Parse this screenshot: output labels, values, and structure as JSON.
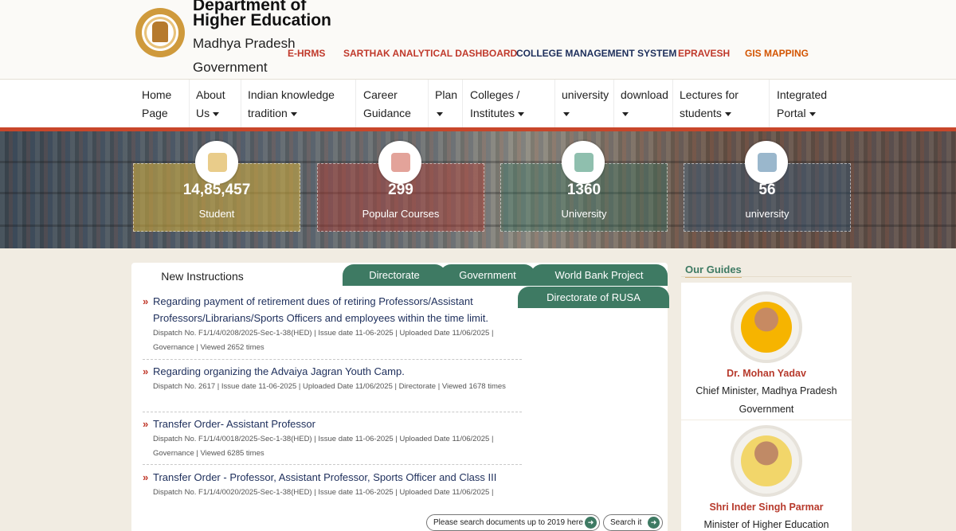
{
  "brand": {
    "title": "Department of Higher Education",
    "subtitle": "Madhya Pradesh Government"
  },
  "quick_links": [
    {
      "label": "E-HRMS",
      "color": "#c0392b"
    },
    {
      "label": "SARTHAK ANALYTICAL DASHBOARD",
      "color": "#c0392b"
    },
    {
      "label": "COLLEGE MANAGEMENT SYSTEM",
      "color": "#1d2e5b"
    },
    {
      "label": "EPRAVESH",
      "color": "#c0392b"
    },
    {
      "label": "GIS MAPPING",
      "color": "#d35400"
    }
  ],
  "nav": {
    "items": [
      {
        "label": "Home Page"
      },
      {
        "label": "About Us"
      },
      {
        "label": "Indian knowledge tradition"
      },
      {
        "label": "Career Guidance"
      },
      {
        "label": "Plan"
      },
      {
        "label": "Colleges / Institutes"
      },
      {
        "label": "university"
      },
      {
        "label": "download"
      },
      {
        "label": "Lectures for students"
      },
      {
        "label": "Integrated Portal"
      }
    ]
  },
  "stats": [
    {
      "value": "14,85,457",
      "label": "Student",
      "icon": "student-graduate-icon"
    },
    {
      "value": "299",
      "label": "Popular Courses",
      "icon": "courses-icon"
    },
    {
      "value": "1360",
      "label": "University",
      "icon": "university-building-icon"
    },
    {
      "value": "56",
      "label": "university",
      "icon": "certificate-icon"
    }
  ],
  "tabs": {
    "active": "New Instructions",
    "others": [
      "Directorate",
      "Government",
      "World Bank Project",
      "Directorate of RUSA"
    ]
  },
  "entries": [
    {
      "title": "Regarding payment of retirement dues of retiring Professors/Assistant Professors/Librarians/Sports Officers and employees within the time limit.",
      "meta": "Dispatch No. F1/1/4/0208/2025-Sec-1-38(HED) | Issue date 11-06-2025 | Uploaded Date 11/06/2025 | Governance | Viewed 2652 times"
    },
    {
      "title": "Regarding organizing the Advaiya Jagran Youth Camp.",
      "meta": "Dispatch No. 2617 | Issue date 11-06-2025 | Uploaded Date 11/06/2025 | Directorate | Viewed 1678 times"
    },
    {
      "title": "Transfer Order- Assistant Professor",
      "meta": "Dispatch No. F1/1/4/0018/2025-Sec-1-38(HED) | Issue date 11-06-2025 | Uploaded Date 11/06/2025 | Governance | Viewed 6285 times"
    },
    {
      "title": "Transfer Order - Professor, Assistant Professor, Sports Officer and Class III",
      "meta": "Dispatch No. F1/1/4/0020/2025-Sec-1-38(HED) | Issue date 11-06-2025 | Uploaded Date 11/06/2025 |"
    }
  ],
  "buttons": {
    "search_docs": "Please search documents up to 2019 here",
    "search_it": "Search it"
  },
  "guides": {
    "heading": "Our Guides",
    "people": [
      {
        "name": "Dr. Mohan Yadav",
        "role": "Chief Minister, Madhya Pradesh Government"
      },
      {
        "name": "Shri Inder Singh Parmar",
        "role": "Minister of Higher Education"
      }
    ]
  }
}
